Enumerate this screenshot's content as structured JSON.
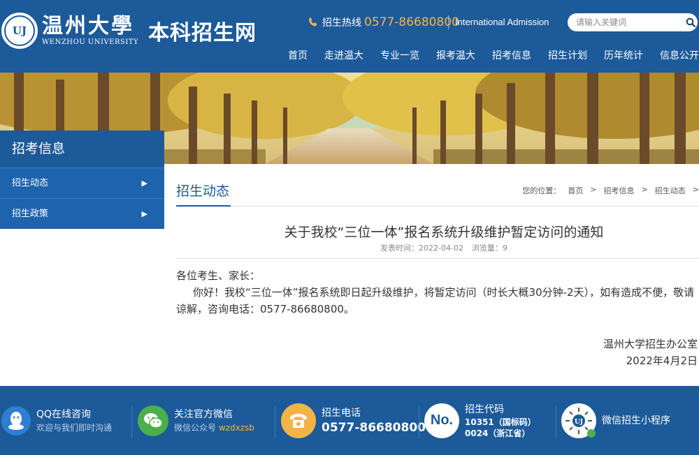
{
  "header": {
    "logo_text": "UJ",
    "university_cn": "温州大學",
    "university_en": "WENZHOU UNIVERSITY",
    "site_name": "本科招生网",
    "hotline_label": "招生热线",
    "hotline_number": "0577-86680800",
    "international": "International Admission",
    "search_placeholder": "请输入关键词"
  },
  "nav": {
    "items": [
      "首页",
      "走进温大",
      "专业一览",
      "报考温大",
      "招考信息",
      "招生计划",
      "历年统计",
      "信息公开"
    ]
  },
  "sidebar": {
    "title": "招考信息",
    "items": [
      {
        "label": "招生动态"
      },
      {
        "label": "招生政策"
      }
    ]
  },
  "main": {
    "section_title": "招生动态",
    "breadcrumb": [
      "您的位置：",
      "首页",
      ">",
      "招考信息",
      ">",
      "招生动态",
      ">"
    ]
  },
  "article": {
    "title": "关于我校“三位一体”报名系统升级维护暂定访问的通知",
    "publish_label": "发表时间：2022-04-02",
    "views_label": "浏览量：9",
    "greeting": "各位考生、家长：",
    "body": "你好！我校“三位一体”报名系统即日起升级维护，将暂定访问（时长大概30分钟-2天），如有造成不便，敬请谅解，咨询电话：0577-86680800。",
    "signature": "温州大学招生办公室",
    "date": "2022年4月2日"
  },
  "footer": {
    "qq": {
      "title": "QQ在线咨询",
      "sub": "欢迎与我们即时沟通"
    },
    "wechat": {
      "title": "关注官方微信",
      "sub": "微信公众号",
      "account": "wzdxzsb"
    },
    "phone": {
      "title": "招生电话",
      "number": "0577-86680800"
    },
    "code": {
      "badge": "No.",
      "title": "招生代码",
      "line1": "10351（国标码）",
      "line2": "0024（浙江省）"
    },
    "mini": {
      "title": "微信招生小程序"
    }
  },
  "colors": {
    "primary": "#1c5a9a",
    "accent": "#f6b541",
    "sidebar_item": "#1d63ae"
  }
}
